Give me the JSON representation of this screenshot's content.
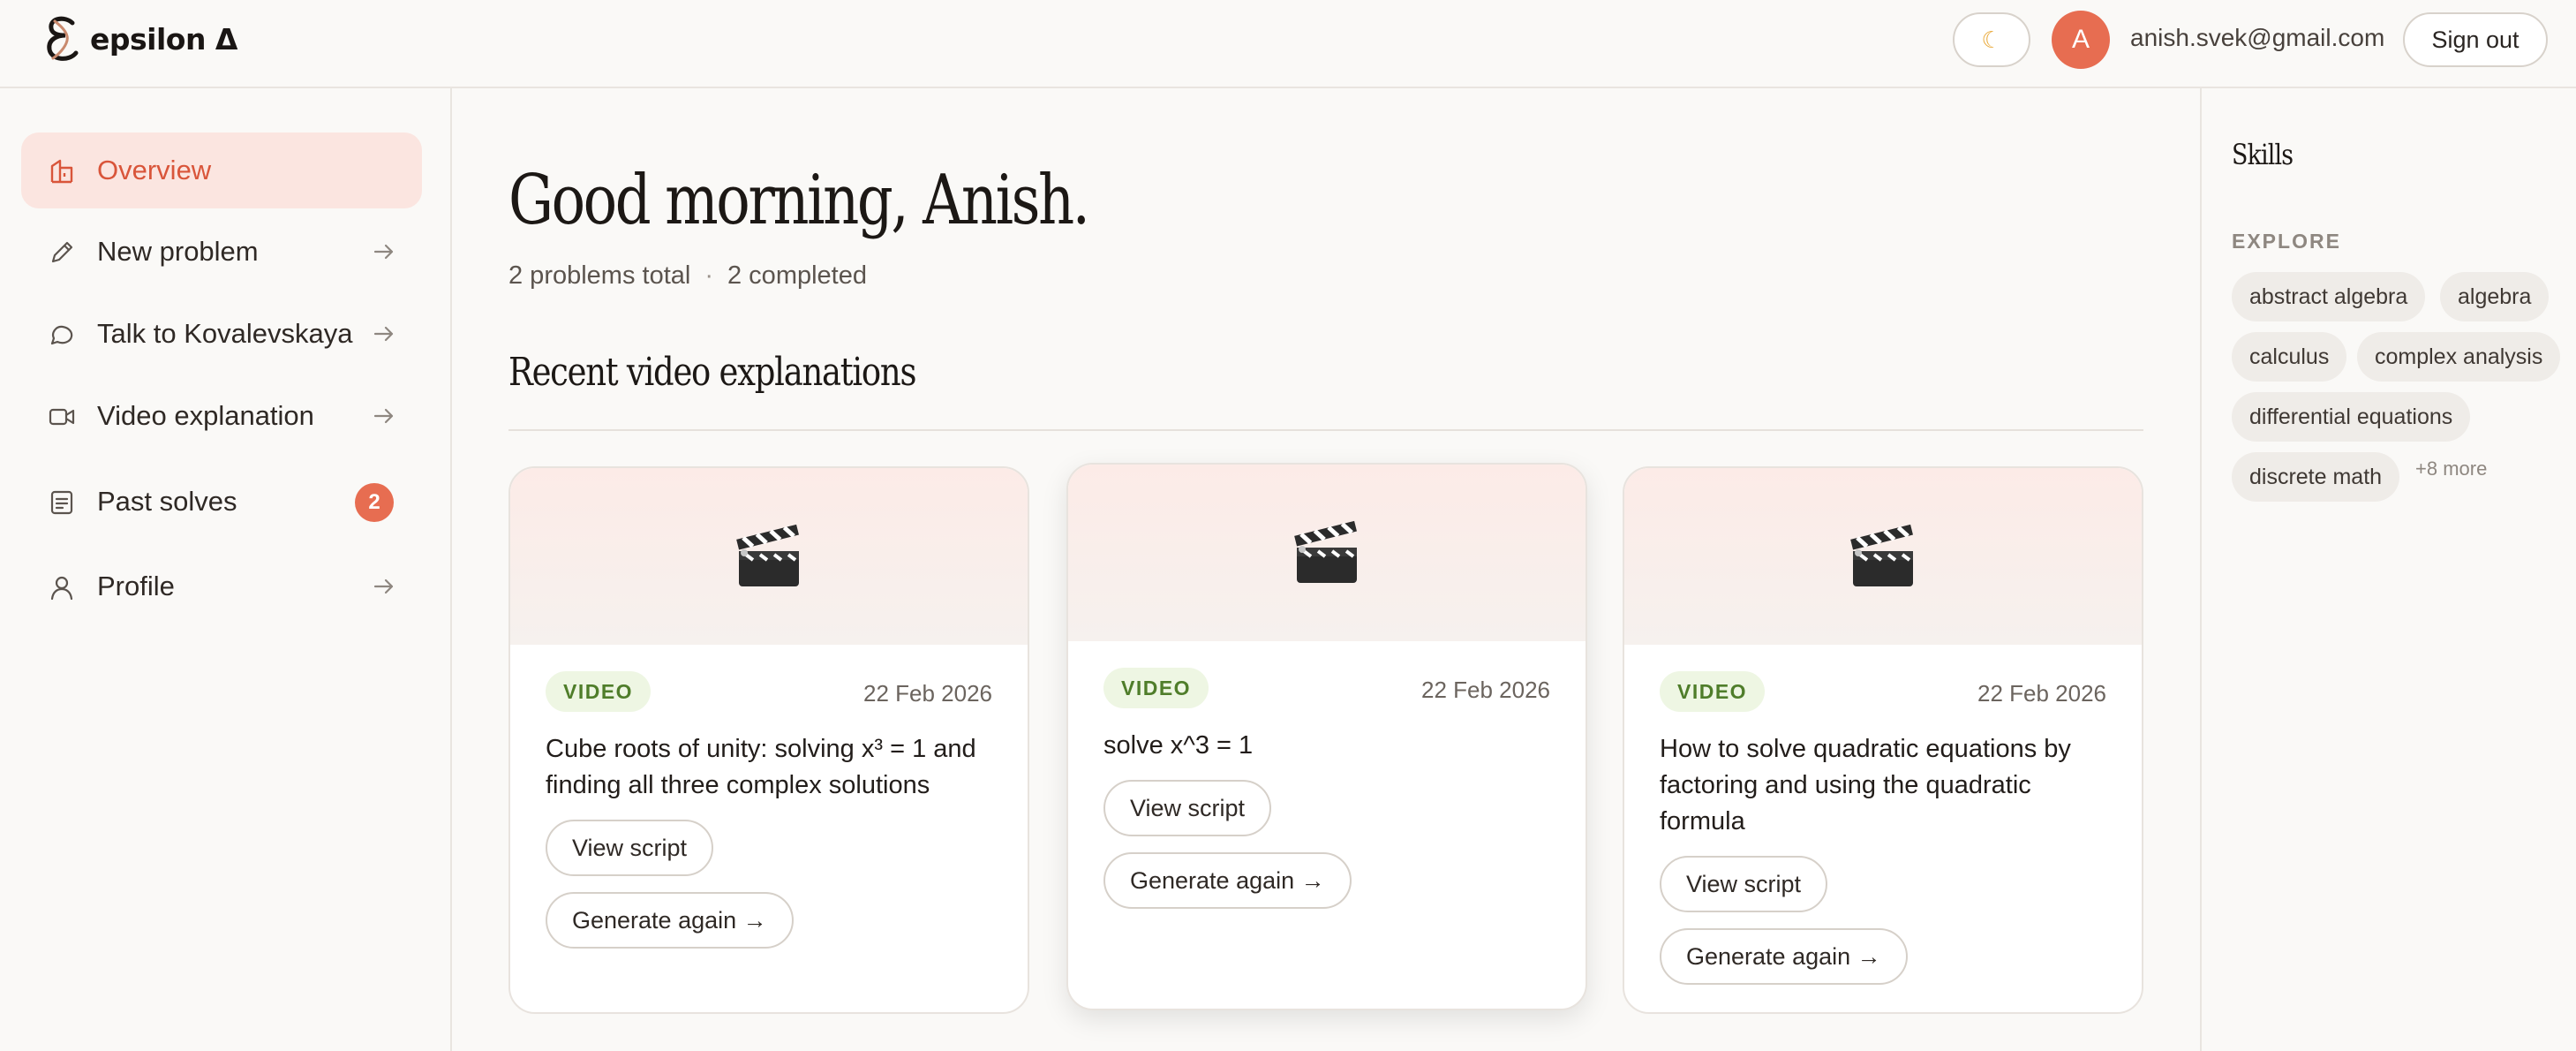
{
  "header": {
    "brand": "epsilon Δ",
    "theme_icon": "moon-icon",
    "avatar_initial": "A",
    "email": "anish.svek@gmail.com",
    "sign_out": "Sign out"
  },
  "sidebar": {
    "items": [
      {
        "label": "Overview",
        "icon": "home-icon",
        "active": true
      },
      {
        "label": "New problem",
        "icon": "pencil-icon"
      },
      {
        "label": "Talk to Kovalevskaya",
        "icon": "chat-bubble-icon"
      },
      {
        "label": "Video explanation",
        "icon": "video-camera-icon"
      },
      {
        "label": "Past solves",
        "icon": "document-icon",
        "badge": "2"
      },
      {
        "label": "Profile",
        "icon": "user-icon"
      }
    ]
  },
  "main": {
    "greeting": "Good morning, Anish.",
    "summary_total": "2 problems total",
    "summary_sep": "·",
    "summary_completed": "2 completed",
    "section_title": "Recent video explanations",
    "cards": [
      {
        "tag": "VIDEO",
        "date": "22 Feb 2026",
        "title": "Cube roots of unity: solving x³ = 1 and finding all three complex solutions",
        "view": "View script",
        "regen": "Generate again →"
      },
      {
        "tag": "VIDEO",
        "date": "22 Feb 2026",
        "title": "solve x^3 = 1",
        "view": "View script",
        "regen": "Generate again →"
      },
      {
        "tag": "VIDEO",
        "date": "22 Feb 2026",
        "title": "How to solve quadratic equations by factoring and using the quadratic formula",
        "view": "View script",
        "regen": "Generate again →"
      }
    ]
  },
  "skills": {
    "title": "Skills",
    "explore_label": "EXPLORE",
    "chips": [
      "abstract algebra",
      "algebra",
      "calculus",
      "complex analysis",
      "differential equations",
      "discrete math"
    ],
    "more": "+8 more"
  },
  "colors": {
    "accent": "#e76d51",
    "active_bg": "#fbe5e0",
    "tag_green": "#4f7d2a"
  }
}
